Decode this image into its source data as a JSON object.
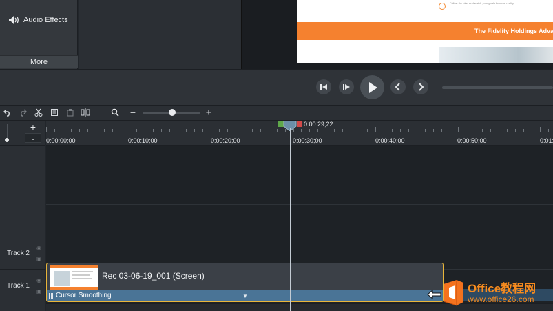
{
  "left_panel": {
    "audio_effects_label": "Audio Effects",
    "more_label": "More"
  },
  "preview": {
    "small_text": "Follow the plan and watch your goals become reality.",
    "banner_text": "The Fidelity Holdings Adva"
  },
  "playback": {
    "icons": [
      "step-back-icon",
      "step-forward-icon",
      "play-icon",
      "previous-marker-icon",
      "next-marker-icon"
    ]
  },
  "toolbar": {
    "icons": [
      "undo-icon",
      "redo-icon",
      "cut-icon",
      "copy-icon",
      "paste-icon",
      "split-icon",
      "zoom-search-icon"
    ],
    "zoom_out": "−",
    "zoom_in": "+",
    "zoom_level": 0.5
  },
  "timeline": {
    "add_track": "+",
    "collapse": "⌄",
    "ruler_labels": [
      "0:00:00;00",
      "0:00:10;00",
      "0:00:20;00",
      "0:00:30;00",
      "0:00:40;00",
      "0:00:50;00",
      "0:01:"
    ],
    "playhead_time": "0:00:29;22",
    "tracks": [
      {
        "name": "Track 2"
      },
      {
        "name": "Track 1"
      }
    ],
    "clip": {
      "title": "Rec 03-06-19_001 (Screen)",
      "effect": "Cursor Smoothing"
    }
  },
  "watermark": {
    "title": "Office教程网",
    "url": "www.office26.com"
  },
  "colors": {
    "clip_border": "#e8b53a",
    "effect_bar": "#4a7496",
    "accent_orange": "#f5812f",
    "in_marker": "#5fa84a",
    "out_marker": "#d24a4a"
  }
}
